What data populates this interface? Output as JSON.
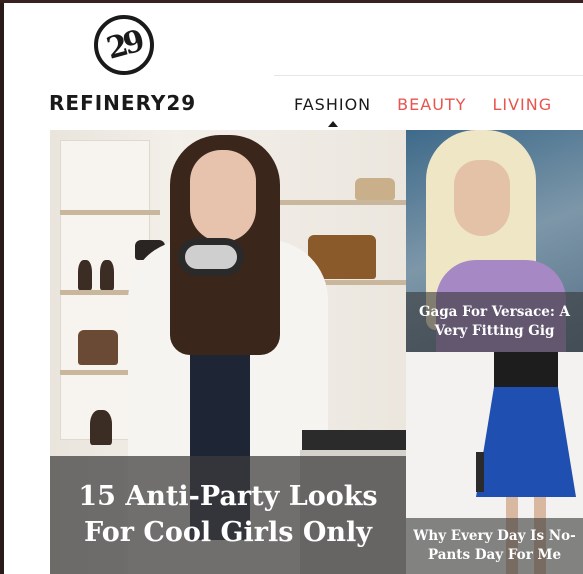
{
  "brand": {
    "logo_mark": "29",
    "name": "REFINERY29"
  },
  "nav": {
    "items": [
      {
        "label": "FASHION",
        "active": true
      },
      {
        "label": "BEAUTY",
        "active": false
      },
      {
        "label": "LIVING",
        "active": false
      }
    ],
    "accent_color": "#e8544f"
  },
  "hero": {
    "headline": "15 Anti-Party Looks For Cool Girls Only"
  },
  "side_stories": [
    {
      "headline": "Gaga For Versace: A Very Fitting Gig"
    },
    {
      "headline": "Why Every Day Is No-Pants Day For Me"
    }
  ]
}
